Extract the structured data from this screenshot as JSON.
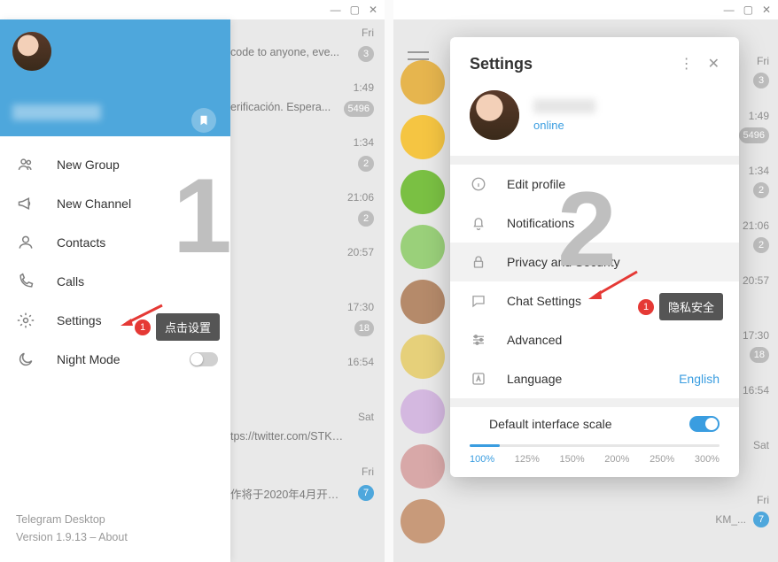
{
  "window_controls": {
    "minimize": "—",
    "maximize": "▢",
    "close": "✕"
  },
  "left": {
    "big_number": "1",
    "menu": [
      {
        "key": "new-group",
        "label": "New Group"
      },
      {
        "key": "new-channel",
        "label": "New Channel"
      },
      {
        "key": "contacts",
        "label": "Contacts"
      },
      {
        "key": "calls",
        "label": "Calls"
      },
      {
        "key": "settings",
        "label": "Settings"
      },
      {
        "key": "night-mode",
        "label": "Night Mode"
      }
    ],
    "footer": {
      "line1": "Telegram Desktop",
      "line2": "Version 1.9.13 – About"
    },
    "callout": {
      "num": "1",
      "text": "点击设置"
    },
    "chats": [
      {
        "time": "Fri",
        "snippet": "code to anyone, eve...",
        "badge": "3"
      },
      {
        "time": "1:49",
        "snippet": "erificación. Espera...",
        "badge": "5496"
      },
      {
        "time": "1:34",
        "snippet": "",
        "badge": "2"
      },
      {
        "time": "21:06",
        "snippet": "",
        "badge": "2"
      },
      {
        "time": "20:57",
        "snippet": "",
        "badge": ""
      },
      {
        "time": "17:30",
        "snippet": "",
        "badge": "18"
      },
      {
        "time": "16:54",
        "snippet": "",
        "badge": ""
      },
      {
        "time": "Sat",
        "snippet": "tps://twitter.com/STKM_...",
        "badge": ""
      },
      {
        "time": "Fri",
        "snippet": "作将于2020年4月开播...",
        "badge": "7",
        "blue": true
      }
    ]
  },
  "right": {
    "big_number": "2",
    "settings_title": "Settings",
    "profile_status": "online",
    "items": [
      {
        "key": "edit-profile",
        "label": "Edit profile"
      },
      {
        "key": "notifications",
        "label": "Notifications"
      },
      {
        "key": "privacy",
        "label": "Privacy and Security"
      },
      {
        "key": "chat-settings",
        "label": "Chat Settings"
      },
      {
        "key": "advanced",
        "label": "Advanced"
      },
      {
        "key": "language",
        "label": "Language",
        "value": "English"
      }
    ],
    "scale": {
      "label": "Default interface scale",
      "ticks": [
        "100%",
        "125%",
        "150%",
        "200%",
        "250%",
        "300%"
      ]
    },
    "callout": {
      "num": "1",
      "text": "隐私安全"
    },
    "side": [
      {
        "time": "Fri",
        "badge": "3",
        "color": "#e6b54e"
      },
      {
        "time": "1:49",
        "badge": "5496",
        "color": "#f5c542"
      },
      {
        "time": "1:34",
        "badge": "2",
        "color": "#7ac043"
      },
      {
        "time": "21:06",
        "badge": "2",
        "color": "#9ad07a"
      },
      {
        "time": "20:57",
        "badge": "",
        "color": "#b58a6a"
      },
      {
        "time": "17:30",
        "badge": "18",
        "color": "#e6d07a"
      },
      {
        "time": "16:54",
        "badge": "",
        "color": "#d4b8e0"
      },
      {
        "time": "Sat",
        "badge": "",
        "color": "#d8a8a8"
      },
      {
        "time": "Fri",
        "badge": "7",
        "blue": true,
        "color": "#c89a7a",
        "snippet": "KM_..."
      }
    ]
  }
}
